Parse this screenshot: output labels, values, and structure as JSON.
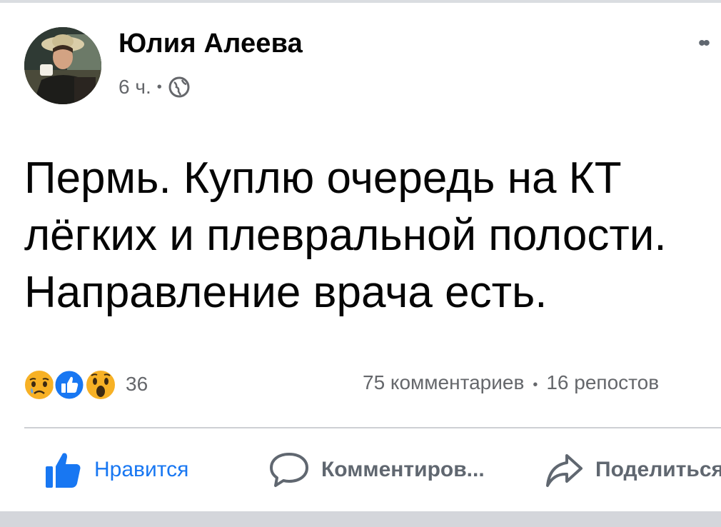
{
  "post": {
    "author_name": "Юлия Алеева",
    "time": "6 ч.",
    "separator": "•",
    "privacy_icon": "globe-icon",
    "more_icon": "more-options-icon",
    "text_lines": [
      "Пермь. Куплю очередь на КТ",
      "лёгких и плевральной полости.",
      "Направление врача есть."
    ]
  },
  "reactions": {
    "icons": [
      "sad-reaction-icon",
      "like-reaction-icon",
      "wow-reaction-icon"
    ],
    "count": "36"
  },
  "stats": {
    "comments": "75 комментариев",
    "separator": "•",
    "shares": "16 репостов"
  },
  "actions": {
    "like": "Нравится",
    "comment": "Комментиров...",
    "share": "Поделиться"
  },
  "colors": {
    "accent": "#1877f2",
    "secondary_text": "#65676b",
    "divider": "#ced0d4"
  }
}
